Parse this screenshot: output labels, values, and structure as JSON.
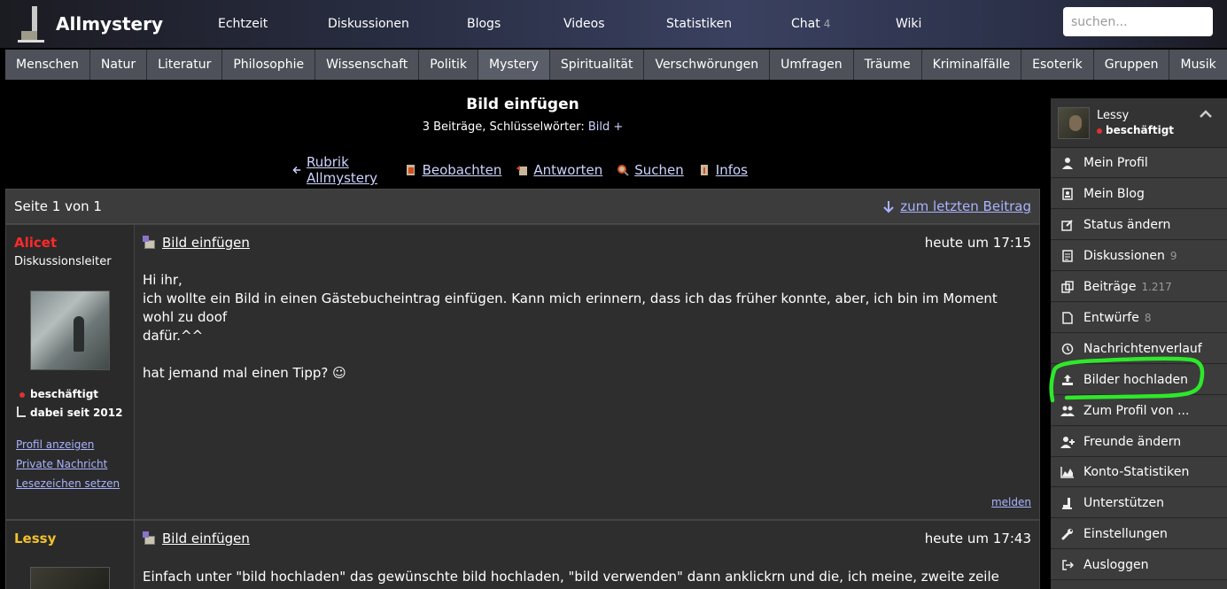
{
  "header": {
    "logo_text": "Allmystery",
    "nav": [
      {
        "label": "Echtzeit"
      },
      {
        "label": "Diskussionen"
      },
      {
        "label": "Blogs"
      },
      {
        "label": "Videos"
      },
      {
        "label": "Statistiken"
      },
      {
        "label": "Chat",
        "count": "4"
      },
      {
        "label": "Wiki"
      }
    ],
    "search_placeholder": "suchen..."
  },
  "categories": [
    "Menschen",
    "Natur",
    "Literatur",
    "Philosophie",
    "Wissenschaft",
    "Politik",
    "Mystery",
    "Spiritualität",
    "Verschwörungen",
    "Umfragen",
    "Träume",
    "Kriminalfälle",
    "Esoterik",
    "Gruppen",
    "Musik"
  ],
  "thread": {
    "title": "Bild einfügen",
    "meta_prefix": "3 Beiträge, Schlüsselwörter: ",
    "keyword": "Bild",
    "plus": "+",
    "actions": [
      "Rubrik Allmystery",
      "Beobachten",
      "Antworten",
      "Suchen",
      "Infos"
    ]
  },
  "pager": {
    "page_info": "Seite 1 von 1",
    "last_post": "zum letzten Beitrag"
  },
  "posts": [
    {
      "author": "Alicet",
      "role": "Diskussionsleiter",
      "status": "beschäftigt",
      "since": "dabei seit 2012",
      "links": [
        "Profil anzeigen",
        "Private Nachricht",
        "Lesezeichen setzen"
      ],
      "title": "Bild einfügen",
      "time": "heute um 17:15",
      "lines": [
        "Hi ihr,",
        "ich wollte ein Bild in einen Gästebucheintrag einfügen. Kann mich erinnern, dass ich das früher konnte, aber, ich bin im Moment wohl zu doof",
        "dafür.^^",
        "",
        "hat jemand mal einen Tipp? ☺"
      ],
      "report": "melden"
    },
    {
      "author": "Lessy",
      "title": "Bild einfügen",
      "time": "heute um 17:43",
      "lines": [
        "Einfach unter \"bild hochladen\" das gewünschte bild hochladen, \"bild verwenden\" dann anklickrn und die, ich meine, zweite zeile kopieren, die"
      ]
    }
  ],
  "sidebar": {
    "user": "Lessy",
    "status": "beschäftigt",
    "items": [
      {
        "label": "Mein Profil",
        "icon": "user-icon"
      },
      {
        "label": "Mein Blog",
        "icon": "blog-icon"
      },
      {
        "label": "Status ändern",
        "icon": "edit-icon"
      },
      {
        "label": "Diskussionen",
        "count": "9",
        "icon": "document-icon"
      },
      {
        "label": "Beiträge",
        "count": "1.217",
        "icon": "copy-icon"
      },
      {
        "label": "Entwürfe",
        "count": "8",
        "icon": "file-icon"
      },
      {
        "label": "Nachrichtenverlauf",
        "icon": "history-icon"
      },
      {
        "label": "Bilder hochladen",
        "icon": "upload-icon"
      },
      {
        "label": "Zum Profil von ...",
        "icon": "users-icon"
      },
      {
        "label": "Freunde ändern",
        "icon": "user-plus-icon"
      },
      {
        "label": "Konto-Statistiken",
        "icon": "chart-icon"
      },
      {
        "label": "Unterstützen",
        "icon": "support-icon"
      },
      {
        "label": "Einstellungen",
        "icon": "wrench-icon"
      },
      {
        "label": "Ausloggen",
        "icon": "logout-icon"
      }
    ]
  },
  "colors": {
    "author_admin": "#ff2a2a",
    "author_user": "#f2c12e",
    "highlight": "#2ee82a",
    "link": "#aab4ff"
  }
}
